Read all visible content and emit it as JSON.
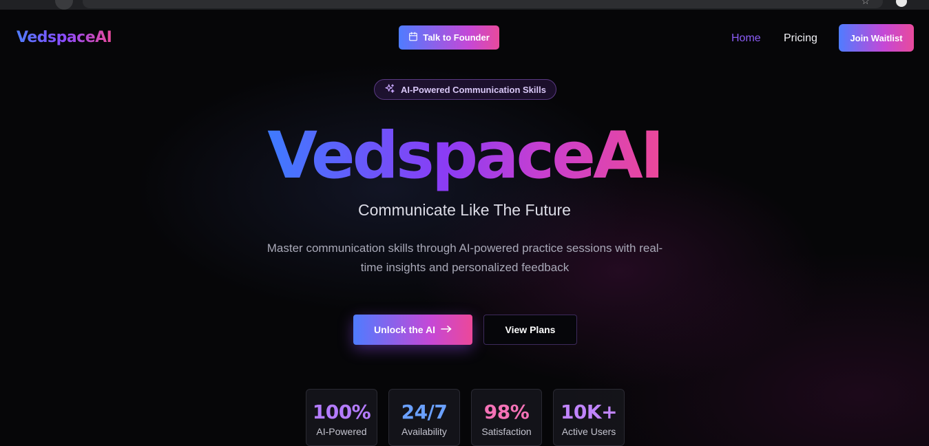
{
  "colors": {
    "accent_blue": "#4f7cff",
    "accent_purple": "#8b5cf6",
    "accent_pink": "#ec4899",
    "background": "#060608"
  },
  "header": {
    "logo": "VedspaceAI",
    "founder_button": {
      "label": "Talk to Founder",
      "icon": "calendar-icon"
    },
    "nav": {
      "home": "Home",
      "pricing": "Pricing"
    },
    "waitlist_button": "Join Waitlist"
  },
  "hero": {
    "badge": {
      "label": "AI-Powered Communication Skills",
      "icon": "sparkles-icon"
    },
    "title": "VedspaceAI",
    "subtitle": "Communicate Like The Future",
    "description": "Master communication skills through AI-powered practice sessions with real-time insights and personalized feedback",
    "primary_button": {
      "label": "Unlock the AI",
      "icon": "arrow-right-icon"
    },
    "secondary_button": "View Plans"
  },
  "stats": [
    {
      "value": "100%",
      "label": "AI-Powered",
      "color": "#b47cff"
    },
    {
      "value": "24/7",
      "label": "Availability",
      "color": "#6aa0ff"
    },
    {
      "value": "98%",
      "label": "Satisfaction",
      "color": "#f472b6"
    },
    {
      "value": "10K+",
      "label": "Active Users",
      "color": "#c084fc"
    }
  ]
}
